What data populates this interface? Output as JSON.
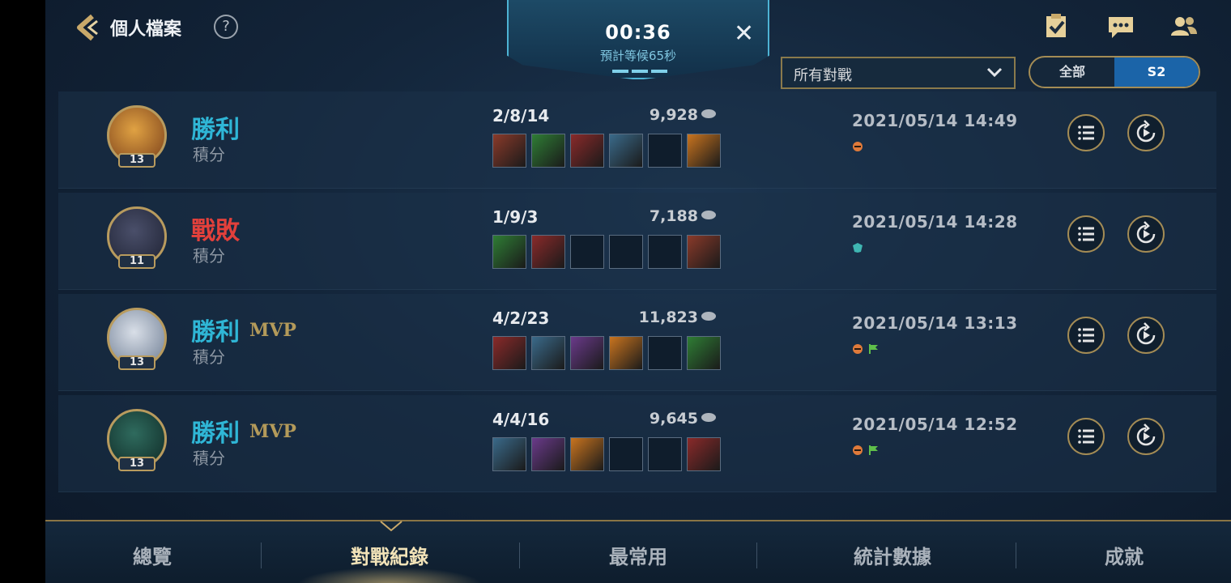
{
  "header": {
    "title": "個人檔案",
    "help_label": "?"
  },
  "queue": {
    "timer": "00:36",
    "estimate": "預計等候65秒"
  },
  "filter": {
    "selected": "所有對戰"
  },
  "season_toggle": {
    "all_label": "全部",
    "s2_label": "S2",
    "selected": "S2"
  },
  "matches": [
    {
      "result": "勝利",
      "outcome": "win",
      "mvp": "",
      "mode": "積分",
      "level": "13",
      "kda": "2/8/14",
      "gold": "9,928",
      "datetime": "2021/05/14 14:49",
      "items": [
        "item",
        "item",
        "item",
        "item",
        "empty",
        "item"
      ],
      "tags": [
        "orange-tag"
      ]
    },
    {
      "result": "戰敗",
      "outcome": "loss",
      "mvp": "",
      "mode": "積分",
      "level": "11",
      "kda": "1/9/3",
      "gold": "7,188",
      "datetime": "2021/05/14 14:28",
      "items": [
        "item",
        "item",
        "empty",
        "empty",
        "empty",
        "item"
      ],
      "tags": [
        "teal-shield-tag"
      ]
    },
    {
      "result": "勝利",
      "outcome": "win",
      "mvp": "MVP",
      "mode": "積分",
      "level": "13",
      "kda": "4/2/23",
      "gold": "11,823",
      "datetime": "2021/05/14 13:13",
      "items": [
        "item",
        "item",
        "item",
        "item",
        "empty",
        "item"
      ],
      "tags": [
        "orange-tag",
        "green-flag-tag"
      ]
    },
    {
      "result": "勝利",
      "outcome": "win",
      "mvp": "MVP",
      "mode": "積分",
      "level": "13",
      "kda": "4/4/16",
      "gold": "9,645",
      "datetime": "2021/05/14 12:52",
      "items": [
        "item",
        "item",
        "item",
        "empty",
        "empty",
        "item"
      ],
      "tags": [
        "orange-tag",
        "green-flag-tag"
      ]
    }
  ],
  "nav": {
    "tabs": [
      "總覽",
      "對戰紀錄",
      "最常用",
      "統計數據",
      "成就"
    ],
    "active": "對戰紀錄"
  },
  "icons": [
    "back-arrow-icon",
    "help-icon",
    "close-icon",
    "task-checklist-icon",
    "chat-icon",
    "friends-icon",
    "chevron-down-icon",
    "gold-coin-icon",
    "list-details-icon",
    "replay-icon"
  ],
  "colors": {
    "win": "#2fb6d6",
    "loss": "#e2403b",
    "gold_accent": "#b89b5e",
    "active_segment": "#1b64a8"
  }
}
